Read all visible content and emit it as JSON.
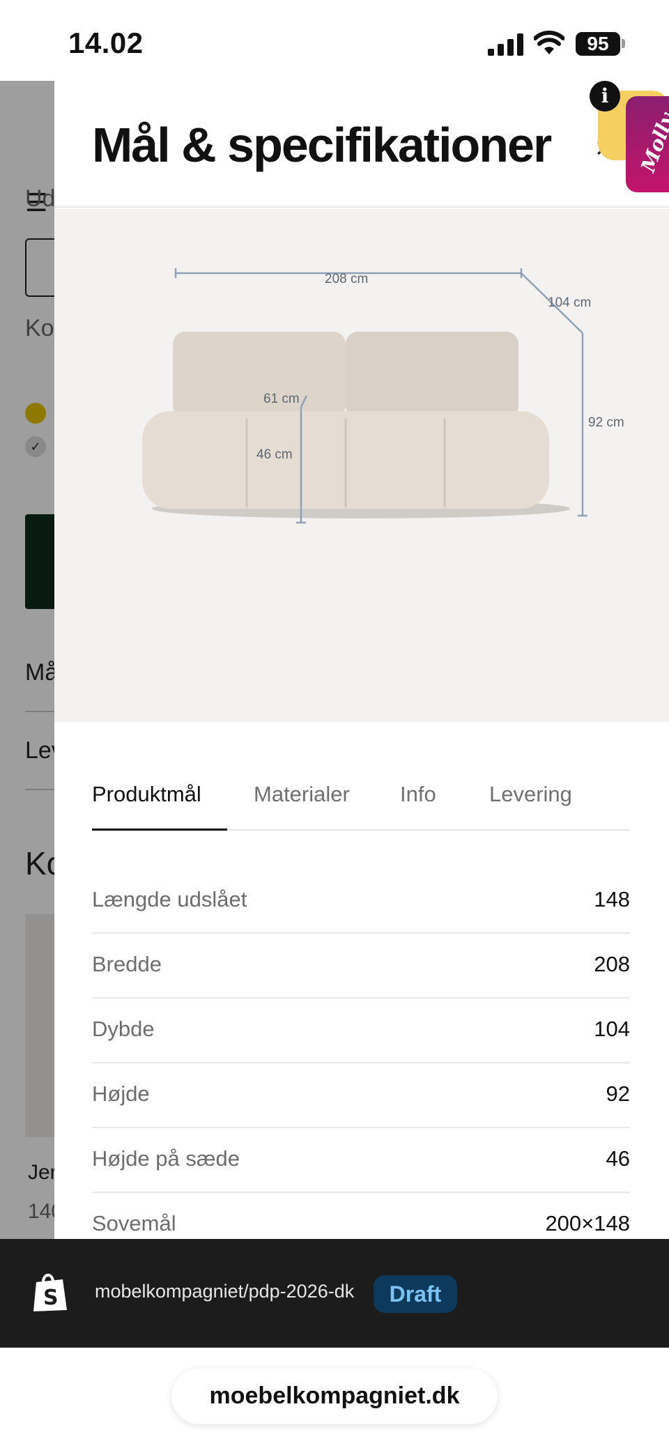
{
  "status_bar": {
    "time": "14.02",
    "battery": "95"
  },
  "background_page": {
    "fragments": [
      "Ud",
      "Ko",
      "Må",
      "Lev",
      "Ko",
      "Jer",
      "140"
    ]
  },
  "sheet": {
    "title": "Mål & specifikationer",
    "close_icon": "×",
    "dimension_labels": {
      "width": "208 cm",
      "depth": "104 cm",
      "height": "92 cm",
      "seat_depth": "61 cm",
      "seat_height": "46 cm"
    },
    "tabs": [
      {
        "label": "Produktmål",
        "active": true
      },
      {
        "label": "Materialer",
        "active": false
      },
      {
        "label": "Info",
        "active": false
      },
      {
        "label": "Levering",
        "active": false
      }
    ],
    "specs": [
      {
        "label": "Længde udslået",
        "value": "148"
      },
      {
        "label": "Bredde",
        "value": "208"
      },
      {
        "label": "Dybde",
        "value": "104"
      },
      {
        "label": "Højde",
        "value": "92"
      },
      {
        "label": "Højde på sæde",
        "value": "46"
      },
      {
        "label": "Sovemål",
        "value": "200×148"
      }
    ]
  },
  "chat_widget": {
    "info_icon": "i",
    "label": "Molly"
  },
  "draft_bar": {
    "path": "mobelkompagniet/pdp-2026-dk",
    "badge": "Draft"
  },
  "browser": {
    "url": "moebelkompagniet.dk"
  },
  "colors": {
    "accent_dark_green": "#0f2a1e",
    "draft_badge_bg": "#0d3a5c",
    "draft_badge_text": "#7cc2f2",
    "molly_tab": "#b3176b",
    "molly_yellow": "#f6cf62"
  }
}
